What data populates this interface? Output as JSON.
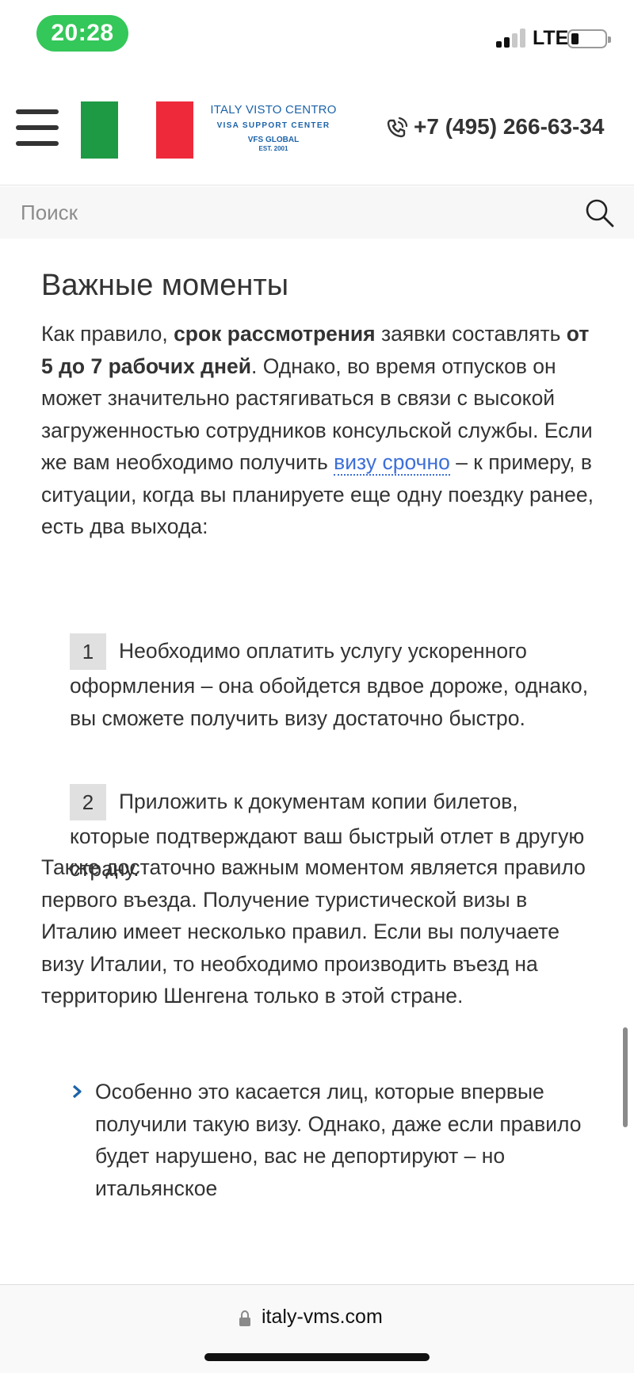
{
  "status_bar": {
    "time": "20:28",
    "network": "LTE"
  },
  "header": {
    "brand": {
      "line1": "ITALY VISTO CENTRO",
      "line2": "VISA SUPPORT CENTER",
      "line3": "VFS GLOBAL",
      "line4": "EST. 2001"
    },
    "phone": "+7 (495) 266-63-34"
  },
  "search": {
    "placeholder": "Поиск"
  },
  "article": {
    "heading": "Важные моменты",
    "para1": {
      "t1": "Как правило, ",
      "b1": "срок рассмотрения",
      "t2": " заявки составлять ",
      "b2": "от 5 до 7 рабочих дней",
      "t3": ". Однако, во время отпусков он может значительно растягиваться в связи с высокой загруженностью сотрудников консульской службы. Если же вам необходимо получить ",
      "link": "визу срочно",
      "t4": " – к примеру, в ситуации, когда вы планируете еще одну поездку ранее, есть два выхода:"
    },
    "options": [
      {
        "number": "1",
        "text": "Необходимо оплатить услугу ускоренного оформления – она обойдется вдвое дороже, однако, вы сможете получить визу достаточно быстро."
      },
      {
        "number": "2",
        "text": "Приложить к документам копии билетов, которые подтверждают ваш быстрый отлет в другую страну."
      }
    ],
    "para2": "Также достаточно важным моментом является правило первого въезда. Получение туристической визы в Италию имеет несколько правил. Если вы получаете визу Италии, то необходимо производить въезд на территорию Шенгена только в этой стране.",
    "bullet": "Особенно это касается лиц, которые впервые получили такую визу. Однако, даже если правило будет нарушено, вас не депортируют – но итальянское"
  },
  "browser": {
    "url": "italy-vms.com"
  },
  "colors": {
    "accent_blue": "#1d63a8",
    "link": "#3d6fd8",
    "flag_green": "#1e9a45",
    "flag_red": "#ee2a3a",
    "time_pill": "#34c759"
  }
}
